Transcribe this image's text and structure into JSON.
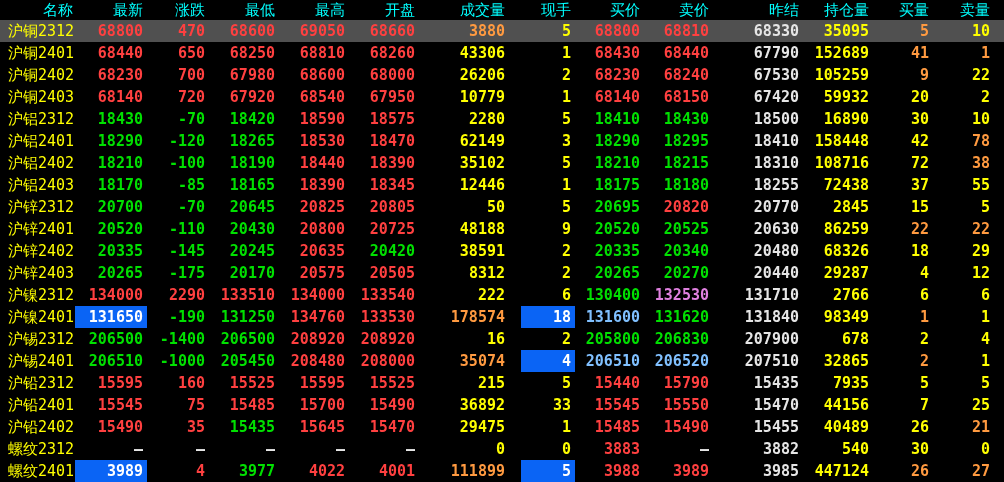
{
  "columns": [
    "名称",
    "最新",
    "涨跌",
    "最低",
    "最高",
    "开盘",
    "成交量",
    "现手",
    "买价",
    "卖价",
    "昨结",
    "持仓量",
    "买量",
    "卖量"
  ],
  "rows": [
    {
      "name": "沪铜2312",
      "selected": true,
      "cells": [
        {
          "text": "68800",
          "color": "#ff4040",
          "highlighted": false
        },
        {
          "text": "470",
          "color": "#ff4040",
          "highlighted": false
        },
        {
          "text": "68600",
          "color": "#ff4040",
          "highlighted": false
        },
        {
          "text": "69050",
          "color": "#ff4040",
          "highlighted": false
        },
        {
          "text": "68660",
          "color": "#ff4040",
          "highlighted": false
        },
        {
          "text": "3880",
          "color": "#ff9a40",
          "highlighted": false
        },
        {
          "text": "5",
          "color": "#ffff00",
          "highlighted": false
        },
        {
          "text": "68800",
          "color": "#ff4040",
          "highlighted": false
        },
        {
          "text": "68810",
          "color": "#ff4040",
          "highlighted": false
        },
        {
          "text": "68330",
          "color": "#e6e6e6",
          "highlighted": false
        },
        {
          "text": "35095",
          "color": "#ffff00",
          "highlighted": false
        },
        {
          "text": "5",
          "color": "#ff9a40",
          "highlighted": false
        },
        {
          "text": "10",
          "color": "#ffff00",
          "highlighted": false
        }
      ]
    },
    {
      "name": "沪铜2401",
      "selected": false,
      "cells": [
        {
          "text": "68440",
          "color": "#ff4040",
          "highlighted": false
        },
        {
          "text": "650",
          "color": "#ff4040",
          "highlighted": false
        },
        {
          "text": "68250",
          "color": "#ff4040",
          "highlighted": false
        },
        {
          "text": "68810",
          "color": "#ff4040",
          "highlighted": false
        },
        {
          "text": "68260",
          "color": "#ff4040",
          "highlighted": false
        },
        {
          "text": "43306",
          "color": "#ffff00",
          "highlighted": false
        },
        {
          "text": "1",
          "color": "#ffff00",
          "highlighted": false
        },
        {
          "text": "68430",
          "color": "#ff4040",
          "highlighted": false
        },
        {
          "text": "68440",
          "color": "#ff4040",
          "highlighted": false
        },
        {
          "text": "67790",
          "color": "#e6e6e6",
          "highlighted": false
        },
        {
          "text": "152689",
          "color": "#ffff00",
          "highlighted": false
        },
        {
          "text": "41",
          "color": "#ff9a40",
          "highlighted": false
        },
        {
          "text": "1",
          "color": "#ff9a40",
          "highlighted": false
        }
      ]
    },
    {
      "name": "沪铜2402",
      "selected": false,
      "cells": [
        {
          "text": "68230",
          "color": "#ff4040",
          "highlighted": false
        },
        {
          "text": "700",
          "color": "#ff4040",
          "highlighted": false
        },
        {
          "text": "67980",
          "color": "#ff4040",
          "highlighted": false
        },
        {
          "text": "68600",
          "color": "#ff4040",
          "highlighted": false
        },
        {
          "text": "68000",
          "color": "#ff4040",
          "highlighted": false
        },
        {
          "text": "26206",
          "color": "#ffff00",
          "highlighted": false
        },
        {
          "text": "2",
          "color": "#ffff00",
          "highlighted": false
        },
        {
          "text": "68230",
          "color": "#ff4040",
          "highlighted": false
        },
        {
          "text": "68240",
          "color": "#ff4040",
          "highlighted": false
        },
        {
          "text": "67530",
          "color": "#e6e6e6",
          "highlighted": false
        },
        {
          "text": "105259",
          "color": "#ffff00",
          "highlighted": false
        },
        {
          "text": "9",
          "color": "#ff9a40",
          "highlighted": false
        },
        {
          "text": "22",
          "color": "#ffff00",
          "highlighted": false
        }
      ]
    },
    {
      "name": "沪铜2403",
      "selected": false,
      "cells": [
        {
          "text": "68140",
          "color": "#ff4040",
          "highlighted": false
        },
        {
          "text": "720",
          "color": "#ff4040",
          "highlighted": false
        },
        {
          "text": "67920",
          "color": "#ff4040",
          "highlighted": false
        },
        {
          "text": "68540",
          "color": "#ff4040",
          "highlighted": false
        },
        {
          "text": "67950",
          "color": "#ff4040",
          "highlighted": false
        },
        {
          "text": "10779",
          "color": "#ffff00",
          "highlighted": false
        },
        {
          "text": "1",
          "color": "#ffff00",
          "highlighted": false
        },
        {
          "text": "68140",
          "color": "#ff4040",
          "highlighted": false
        },
        {
          "text": "68150",
          "color": "#ff4040",
          "highlighted": false
        },
        {
          "text": "67420",
          "color": "#e6e6e6",
          "highlighted": false
        },
        {
          "text": "59932",
          "color": "#ffff00",
          "highlighted": false
        },
        {
          "text": "20",
          "color": "#ffff00",
          "highlighted": false
        },
        {
          "text": "2",
          "color": "#ffff00",
          "highlighted": false
        }
      ]
    },
    {
      "name": "沪铝2312",
      "selected": false,
      "cells": [
        {
          "text": "18430",
          "color": "#00e000",
          "highlighted": false
        },
        {
          "text": "-70",
          "color": "#00e000",
          "highlighted": false
        },
        {
          "text": "18420",
          "color": "#00e000",
          "highlighted": false
        },
        {
          "text": "18590",
          "color": "#ff4040",
          "highlighted": false
        },
        {
          "text": "18575",
          "color": "#ff4040",
          "highlighted": false
        },
        {
          "text": "2280",
          "color": "#ffff00",
          "highlighted": false
        },
        {
          "text": "5",
          "color": "#ffff00",
          "highlighted": false
        },
        {
          "text": "18410",
          "color": "#00e000",
          "highlighted": false
        },
        {
          "text": "18430",
          "color": "#00e000",
          "highlighted": false
        },
        {
          "text": "18500",
          "color": "#e6e6e6",
          "highlighted": false
        },
        {
          "text": "16890",
          "color": "#ffff00",
          "highlighted": false
        },
        {
          "text": "30",
          "color": "#ffff00",
          "highlighted": false
        },
        {
          "text": "10",
          "color": "#ffff00",
          "highlighted": false
        }
      ]
    },
    {
      "name": "沪铝2401",
      "selected": false,
      "cells": [
        {
          "text": "18290",
          "color": "#00e000",
          "highlighted": false
        },
        {
          "text": "-120",
          "color": "#00e000",
          "highlighted": false
        },
        {
          "text": "18265",
          "color": "#00e000",
          "highlighted": false
        },
        {
          "text": "18530",
          "color": "#ff4040",
          "highlighted": false
        },
        {
          "text": "18470",
          "color": "#ff4040",
          "highlighted": false
        },
        {
          "text": "62149",
          "color": "#ffff00",
          "highlighted": false
        },
        {
          "text": "3",
          "color": "#ffff00",
          "highlighted": false
        },
        {
          "text": "18290",
          "color": "#00e000",
          "highlighted": false
        },
        {
          "text": "18295",
          "color": "#00e000",
          "highlighted": false
        },
        {
          "text": "18410",
          "color": "#e6e6e6",
          "highlighted": false
        },
        {
          "text": "158448",
          "color": "#ffff00",
          "highlighted": false
        },
        {
          "text": "42",
          "color": "#ffff00",
          "highlighted": false
        },
        {
          "text": "78",
          "color": "#ff9a40",
          "highlighted": false
        }
      ]
    },
    {
      "name": "沪铝2402",
      "selected": false,
      "cells": [
        {
          "text": "18210",
          "color": "#00e000",
          "highlighted": false
        },
        {
          "text": "-100",
          "color": "#00e000",
          "highlighted": false
        },
        {
          "text": "18190",
          "color": "#00e000",
          "highlighted": false
        },
        {
          "text": "18440",
          "color": "#ff4040",
          "highlighted": false
        },
        {
          "text": "18390",
          "color": "#ff4040",
          "highlighted": false
        },
        {
          "text": "35102",
          "color": "#ffff00",
          "highlighted": false
        },
        {
          "text": "5",
          "color": "#ffff00",
          "highlighted": false
        },
        {
          "text": "18210",
          "color": "#00e000",
          "highlighted": false
        },
        {
          "text": "18215",
          "color": "#00e000",
          "highlighted": false
        },
        {
          "text": "18310",
          "color": "#e6e6e6",
          "highlighted": false
        },
        {
          "text": "108716",
          "color": "#ffff00",
          "highlighted": false
        },
        {
          "text": "72",
          "color": "#ffff00",
          "highlighted": false
        },
        {
          "text": "38",
          "color": "#ff9a40",
          "highlighted": false
        }
      ]
    },
    {
      "name": "沪铝2403",
      "selected": false,
      "cells": [
        {
          "text": "18170",
          "color": "#00e000",
          "highlighted": false
        },
        {
          "text": "-85",
          "color": "#00e000",
          "highlighted": false
        },
        {
          "text": "18165",
          "color": "#00e000",
          "highlighted": false
        },
        {
          "text": "18390",
          "color": "#ff4040",
          "highlighted": false
        },
        {
          "text": "18345",
          "color": "#ff4040",
          "highlighted": false
        },
        {
          "text": "12446",
          "color": "#ffff00",
          "highlighted": false
        },
        {
          "text": "1",
          "color": "#ffff00",
          "highlighted": false
        },
        {
          "text": "18175",
          "color": "#00e000",
          "highlighted": false
        },
        {
          "text": "18180",
          "color": "#00e000",
          "highlighted": false
        },
        {
          "text": "18255",
          "color": "#e6e6e6",
          "highlighted": false
        },
        {
          "text": "72438",
          "color": "#ffff00",
          "highlighted": false
        },
        {
          "text": "37",
          "color": "#ffff00",
          "highlighted": false
        },
        {
          "text": "55",
          "color": "#ffff00",
          "highlighted": false
        }
      ]
    },
    {
      "name": "沪锌2312",
      "selected": false,
      "cells": [
        {
          "text": "20700",
          "color": "#00e000",
          "highlighted": false
        },
        {
          "text": "-70",
          "color": "#00e000",
          "highlighted": false
        },
        {
          "text": "20645",
          "color": "#00e000",
          "highlighted": false
        },
        {
          "text": "20825",
          "color": "#ff4040",
          "highlighted": false
        },
        {
          "text": "20805",
          "color": "#ff4040",
          "highlighted": false
        },
        {
          "text": "50",
          "color": "#ffff00",
          "highlighted": false
        },
        {
          "text": "5",
          "color": "#ffff00",
          "highlighted": false
        },
        {
          "text": "20695",
          "color": "#00e000",
          "highlighted": false
        },
        {
          "text": "20820",
          "color": "#ff4040",
          "highlighted": false
        },
        {
          "text": "20770",
          "color": "#e6e6e6",
          "highlighted": false
        },
        {
          "text": "2845",
          "color": "#ffff00",
          "highlighted": false
        },
        {
          "text": "15",
          "color": "#ffff00",
          "highlighted": false
        },
        {
          "text": "5",
          "color": "#ffff00",
          "highlighted": false
        }
      ]
    },
    {
      "name": "沪锌2401",
      "selected": false,
      "cells": [
        {
          "text": "20520",
          "color": "#00e000",
          "highlighted": false
        },
        {
          "text": "-110",
          "color": "#00e000",
          "highlighted": false
        },
        {
          "text": "20430",
          "color": "#00e000",
          "highlighted": false
        },
        {
          "text": "20800",
          "color": "#ff4040",
          "highlighted": false
        },
        {
          "text": "20725",
          "color": "#ff4040",
          "highlighted": false
        },
        {
          "text": "48188",
          "color": "#ffff00",
          "highlighted": false
        },
        {
          "text": "9",
          "color": "#ffff00",
          "highlighted": false
        },
        {
          "text": "20520",
          "color": "#00e000",
          "highlighted": false
        },
        {
          "text": "20525",
          "color": "#00e000",
          "highlighted": false
        },
        {
          "text": "20630",
          "color": "#e6e6e6",
          "highlighted": false
        },
        {
          "text": "86259",
          "color": "#ffff00",
          "highlighted": false
        },
        {
          "text": "22",
          "color": "#ff9a40",
          "highlighted": false
        },
        {
          "text": "22",
          "color": "#ff9a40",
          "highlighted": false
        }
      ]
    },
    {
      "name": "沪锌2402",
      "selected": false,
      "cells": [
        {
          "text": "20335",
          "color": "#00e000",
          "highlighted": false
        },
        {
          "text": "-145",
          "color": "#00e000",
          "highlighted": false
        },
        {
          "text": "20245",
          "color": "#00e000",
          "highlighted": false
        },
        {
          "text": "20635",
          "color": "#ff4040",
          "highlighted": false
        },
        {
          "text": "20420",
          "color": "#00e000",
          "highlighted": false
        },
        {
          "text": "38591",
          "color": "#ffff00",
          "highlighted": false
        },
        {
          "text": "2",
          "color": "#ffff00",
          "highlighted": false
        },
        {
          "text": "20335",
          "color": "#00e000",
          "highlighted": false
        },
        {
          "text": "20340",
          "color": "#00e000",
          "highlighted": false
        },
        {
          "text": "20480",
          "color": "#e6e6e6",
          "highlighted": false
        },
        {
          "text": "68326",
          "color": "#ffff00",
          "highlighted": false
        },
        {
          "text": "18",
          "color": "#ffff00",
          "highlighted": false
        },
        {
          "text": "29",
          "color": "#ffff00",
          "highlighted": false
        }
      ]
    },
    {
      "name": "沪锌2403",
      "selected": false,
      "cells": [
        {
          "text": "20265",
          "color": "#00e000",
          "highlighted": false
        },
        {
          "text": "-175",
          "color": "#00e000",
          "highlighted": false
        },
        {
          "text": "20170",
          "color": "#00e000",
          "highlighted": false
        },
        {
          "text": "20575",
          "color": "#ff4040",
          "highlighted": false
        },
        {
          "text": "20505",
          "color": "#ff4040",
          "highlighted": false
        },
        {
          "text": "8312",
          "color": "#ffff00",
          "highlighted": false
        },
        {
          "text": "2",
          "color": "#ffff00",
          "highlighted": false
        },
        {
          "text": "20265",
          "color": "#00e000",
          "highlighted": false
        },
        {
          "text": "20270",
          "color": "#00e000",
          "highlighted": false
        },
        {
          "text": "20440",
          "color": "#e6e6e6",
          "highlighted": false
        },
        {
          "text": "29287",
          "color": "#ffff00",
          "highlighted": false
        },
        {
          "text": "4",
          "color": "#ffff00",
          "highlighted": false
        },
        {
          "text": "12",
          "color": "#ffff00",
          "highlighted": false
        }
      ]
    },
    {
      "name": "沪镍2312",
      "selected": false,
      "cells": [
        {
          "text": "134000",
          "color": "#ff4040",
          "highlighted": false
        },
        {
          "text": "2290",
          "color": "#ff4040",
          "highlighted": false
        },
        {
          "text": "133510",
          "color": "#ff4040",
          "highlighted": false
        },
        {
          "text": "134000",
          "color": "#ff4040",
          "highlighted": false
        },
        {
          "text": "133540",
          "color": "#ff4040",
          "highlighted": false
        },
        {
          "text": "222",
          "color": "#ffff00",
          "highlighted": false
        },
        {
          "text": "6",
          "color": "#ffff00",
          "highlighted": false
        },
        {
          "text": "130400",
          "color": "#00e000",
          "highlighted": false
        },
        {
          "text": "132530",
          "color": "#e080e0",
          "highlighted": false
        },
        {
          "text": "131710",
          "color": "#e6e6e6",
          "highlighted": false
        },
        {
          "text": "2766",
          "color": "#ffff00",
          "highlighted": false
        },
        {
          "text": "6",
          "color": "#ffff00",
          "highlighted": false
        },
        {
          "text": "6",
          "color": "#ffff00",
          "highlighted": false
        }
      ]
    },
    {
      "name": "沪镍2401",
      "selected": false,
      "cells": [
        {
          "text": "131650",
          "color": "#ffffff",
          "highlighted": true
        },
        {
          "text": "-190",
          "color": "#00e000",
          "highlighted": false
        },
        {
          "text": "131250",
          "color": "#00e000",
          "highlighted": false
        },
        {
          "text": "134760",
          "color": "#ff4040",
          "highlighted": false
        },
        {
          "text": "133530",
          "color": "#ff4040",
          "highlighted": false
        },
        {
          "text": "178574",
          "color": "#ff9a40",
          "highlighted": false
        },
        {
          "text": "18",
          "color": "#ffffff",
          "highlighted": true
        },
        {
          "text": "131600",
          "color": "#80c0ff",
          "highlighted": false
        },
        {
          "text": "131620",
          "color": "#00e000",
          "highlighted": false
        },
        {
          "text": "131840",
          "color": "#e6e6e6",
          "highlighted": false
        },
        {
          "text": "98349",
          "color": "#ffff00",
          "highlighted": false
        },
        {
          "text": "1",
          "color": "#ff9a40",
          "highlighted": false
        },
        {
          "text": "1",
          "color": "#ffff00",
          "highlighted": false
        }
      ]
    },
    {
      "name": "沪锡2312",
      "selected": false,
      "cells": [
        {
          "text": "206500",
          "color": "#00e000",
          "highlighted": false
        },
        {
          "text": "-1400",
          "color": "#00e000",
          "highlighted": false
        },
        {
          "text": "206500",
          "color": "#00e000",
          "highlighted": false
        },
        {
          "text": "208920",
          "color": "#ff4040",
          "highlighted": false
        },
        {
          "text": "208920",
          "color": "#ff4040",
          "highlighted": false
        },
        {
          "text": "16",
          "color": "#ffff00",
          "highlighted": false
        },
        {
          "text": "2",
          "color": "#ffff00",
          "highlighted": false
        },
        {
          "text": "205800",
          "color": "#00e000",
          "highlighted": false
        },
        {
          "text": "206830",
          "color": "#00e000",
          "highlighted": false
        },
        {
          "text": "207900",
          "color": "#e6e6e6",
          "highlighted": false
        },
        {
          "text": "678",
          "color": "#ffff00",
          "highlighted": false
        },
        {
          "text": "2",
          "color": "#ffff00",
          "highlighted": false
        },
        {
          "text": "4",
          "color": "#ffff00",
          "highlighted": false
        }
      ]
    },
    {
      "name": "沪锡2401",
      "selected": false,
      "cells": [
        {
          "text": "206510",
          "color": "#00e000",
          "highlighted": false
        },
        {
          "text": "-1000",
          "color": "#00e000",
          "highlighted": false
        },
        {
          "text": "205450",
          "color": "#00e000",
          "highlighted": false
        },
        {
          "text": "208480",
          "color": "#ff4040",
          "highlighted": false
        },
        {
          "text": "208000",
          "color": "#ff4040",
          "highlighted": false
        },
        {
          "text": "35074",
          "color": "#ff9a40",
          "highlighted": false
        },
        {
          "text": "4",
          "color": "#ffffff",
          "highlighted": true
        },
        {
          "text": "206510",
          "color": "#80c0ff",
          "highlighted": false
        },
        {
          "text": "206520",
          "color": "#80c0ff",
          "highlighted": false
        },
        {
          "text": "207510",
          "color": "#e6e6e6",
          "highlighted": false
        },
        {
          "text": "32865",
          "color": "#ffff00",
          "highlighted": false
        },
        {
          "text": "2",
          "color": "#ff9a40",
          "highlighted": false
        },
        {
          "text": "1",
          "color": "#ffff00",
          "highlighted": false
        }
      ]
    },
    {
      "name": "沪铅2312",
      "selected": false,
      "cells": [
        {
          "text": "15595",
          "color": "#ff4040",
          "highlighted": false
        },
        {
          "text": "160",
          "color": "#ff4040",
          "highlighted": false
        },
        {
          "text": "15525",
          "color": "#ff4040",
          "highlighted": false
        },
        {
          "text": "15595",
          "color": "#ff4040",
          "highlighted": false
        },
        {
          "text": "15525",
          "color": "#ff4040",
          "highlighted": false
        },
        {
          "text": "215",
          "color": "#ffff00",
          "highlighted": false
        },
        {
          "text": "5",
          "color": "#ffff00",
          "highlighted": false
        },
        {
          "text": "15440",
          "color": "#ff4040",
          "highlighted": false
        },
        {
          "text": "15790",
          "color": "#ff4040",
          "highlighted": false
        },
        {
          "text": "15435",
          "color": "#e6e6e6",
          "highlighted": false
        },
        {
          "text": "7935",
          "color": "#ffff00",
          "highlighted": false
        },
        {
          "text": "5",
          "color": "#ffff00",
          "highlighted": false
        },
        {
          "text": "5",
          "color": "#ffff00",
          "highlighted": false
        }
      ]
    },
    {
      "name": "沪铅2401",
      "selected": false,
      "cells": [
        {
          "text": "15545",
          "color": "#ff4040",
          "highlighted": false
        },
        {
          "text": "75",
          "color": "#ff4040",
          "highlighted": false
        },
        {
          "text": "15485",
          "color": "#ff4040",
          "highlighted": false
        },
        {
          "text": "15700",
          "color": "#ff4040",
          "highlighted": false
        },
        {
          "text": "15490",
          "color": "#ff4040",
          "highlighted": false
        },
        {
          "text": "36892",
          "color": "#ffff00",
          "highlighted": false
        },
        {
          "text": "33",
          "color": "#ffff00",
          "highlighted": false
        },
        {
          "text": "15545",
          "color": "#ff4040",
          "highlighted": false
        },
        {
          "text": "15550",
          "color": "#ff4040",
          "highlighted": false
        },
        {
          "text": "15470",
          "color": "#e6e6e6",
          "highlighted": false
        },
        {
          "text": "44156",
          "color": "#ffff00",
          "highlighted": false
        },
        {
          "text": "7",
          "color": "#ffff00",
          "highlighted": false
        },
        {
          "text": "25",
          "color": "#ffff00",
          "highlighted": false
        }
      ]
    },
    {
      "name": "沪铅2402",
      "selected": false,
      "cells": [
        {
          "text": "15490",
          "color": "#ff4040",
          "highlighted": false
        },
        {
          "text": "35",
          "color": "#ff4040",
          "highlighted": false
        },
        {
          "text": "15435",
          "color": "#00e000",
          "highlighted": false
        },
        {
          "text": "15645",
          "color": "#ff4040",
          "highlighted": false
        },
        {
          "text": "15470",
          "color": "#ff4040",
          "highlighted": false
        },
        {
          "text": "29475",
          "color": "#ffff00",
          "highlighted": false
        },
        {
          "text": "1",
          "color": "#ffff00",
          "highlighted": false
        },
        {
          "text": "15485",
          "color": "#ff4040",
          "highlighted": false
        },
        {
          "text": "15490",
          "color": "#ff4040",
          "highlighted": false
        },
        {
          "text": "15455",
          "color": "#e6e6e6",
          "highlighted": false
        },
        {
          "text": "40489",
          "color": "#ffff00",
          "highlighted": false
        },
        {
          "text": "26",
          "color": "#ffff00",
          "highlighted": false
        },
        {
          "text": "21",
          "color": "#ff9a40",
          "highlighted": false
        }
      ]
    },
    {
      "name": "螺纹2312",
      "selected": false,
      "cells": [
        {
          "text": "—",
          "color": "#e6e6e6",
          "highlighted": false
        },
        {
          "text": "—",
          "color": "#e6e6e6",
          "highlighted": false
        },
        {
          "text": "—",
          "color": "#e6e6e6",
          "highlighted": false
        },
        {
          "text": "—",
          "color": "#e6e6e6",
          "highlighted": false
        },
        {
          "text": "—",
          "color": "#e6e6e6",
          "highlighted": false
        },
        {
          "text": "0",
          "color": "#ffff00",
          "highlighted": false
        },
        {
          "text": "0",
          "color": "#ffff00",
          "highlighted": false
        },
        {
          "text": "3883",
          "color": "#ff4040",
          "highlighted": false
        },
        {
          "text": "—",
          "color": "#e6e6e6",
          "highlighted": false
        },
        {
          "text": "3882",
          "color": "#e6e6e6",
          "highlighted": false
        },
        {
          "text": "540",
          "color": "#ffff00",
          "highlighted": false
        },
        {
          "text": "30",
          "color": "#ffff00",
          "highlighted": false
        },
        {
          "text": "0",
          "color": "#ffff00",
          "highlighted": false
        }
      ]
    },
    {
      "name": "螺纹2401",
      "selected": false,
      "cells": [
        {
          "text": "3989",
          "color": "#ffffff",
          "highlighted": true
        },
        {
          "text": "4",
          "color": "#ff4040",
          "highlighted": false
        },
        {
          "text": "3977",
          "color": "#00e000",
          "highlighted": false
        },
        {
          "text": "4022",
          "color": "#ff4040",
          "highlighted": false
        },
        {
          "text": "4001",
          "color": "#ff4040",
          "highlighted": false
        },
        {
          "text": "111899",
          "color": "#ff9a40",
          "highlighted": false
        },
        {
          "text": "5",
          "color": "#ffffff",
          "highlighted": true
        },
        {
          "text": "3988",
          "color": "#ff4040",
          "highlighted": false
        },
        {
          "text": "3989",
          "color": "#ff4040",
          "highlighted": false
        },
        {
          "text": "3985",
          "color": "#e6e6e6",
          "highlighted": false
        },
        {
          "text": "447124",
          "color": "#ffff00",
          "highlighted": false
        },
        {
          "text": "26",
          "color": "#ff9a40",
          "highlighted": false
        },
        {
          "text": "27",
          "color": "#ff9a40",
          "highlighted": false
        }
      ]
    }
  ]
}
